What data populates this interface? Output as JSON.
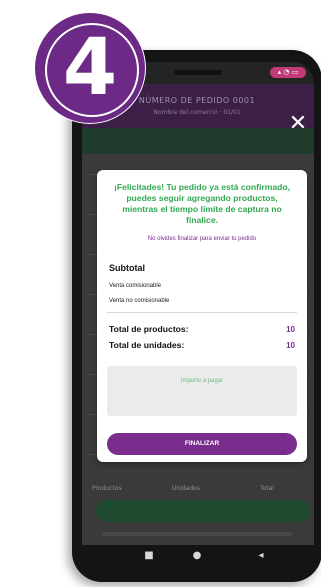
{
  "step_badge": {
    "number": "4"
  },
  "status_bar": {
    "icons": "▴ ◔ ▭"
  },
  "app_bar": {
    "title": "NÚMERO DE PEDIDO 0001",
    "subtitle": "Nombre del comercio · 01/01",
    "close_icon": "close-icon"
  },
  "modal": {
    "message": "¡Felicitades! Tu pedido ya está confirmado, puedes seguir agregando productos, mientras el tiempo límite de captura no finalice.",
    "hint": "No olvides finalizar para enviar tu pedido",
    "subtotal_title": "Subtotal",
    "line_items": [
      "Venta comisionable",
      "Venta no comisionable"
    ],
    "totals": [
      {
        "label": "Total de productos:",
        "value": "10"
      },
      {
        "label": "Total de unidades:",
        "value": "10"
      }
    ],
    "payment_label": "Importe a pagar",
    "finish_button": "FINALIZAR"
  },
  "background_footer": {
    "labels": [
      "Productos",
      "Unidades",
      "Total"
    ]
  },
  "nav_bar": {
    "back_icon": "◂",
    "home_icon": "●",
    "recent_icon": "■"
  },
  "colors": {
    "accent_purple": "#7b2d8e",
    "success_green": "#2fa84f",
    "badge_purple": "#6c2a86",
    "app_bar": "#3c1f47"
  }
}
